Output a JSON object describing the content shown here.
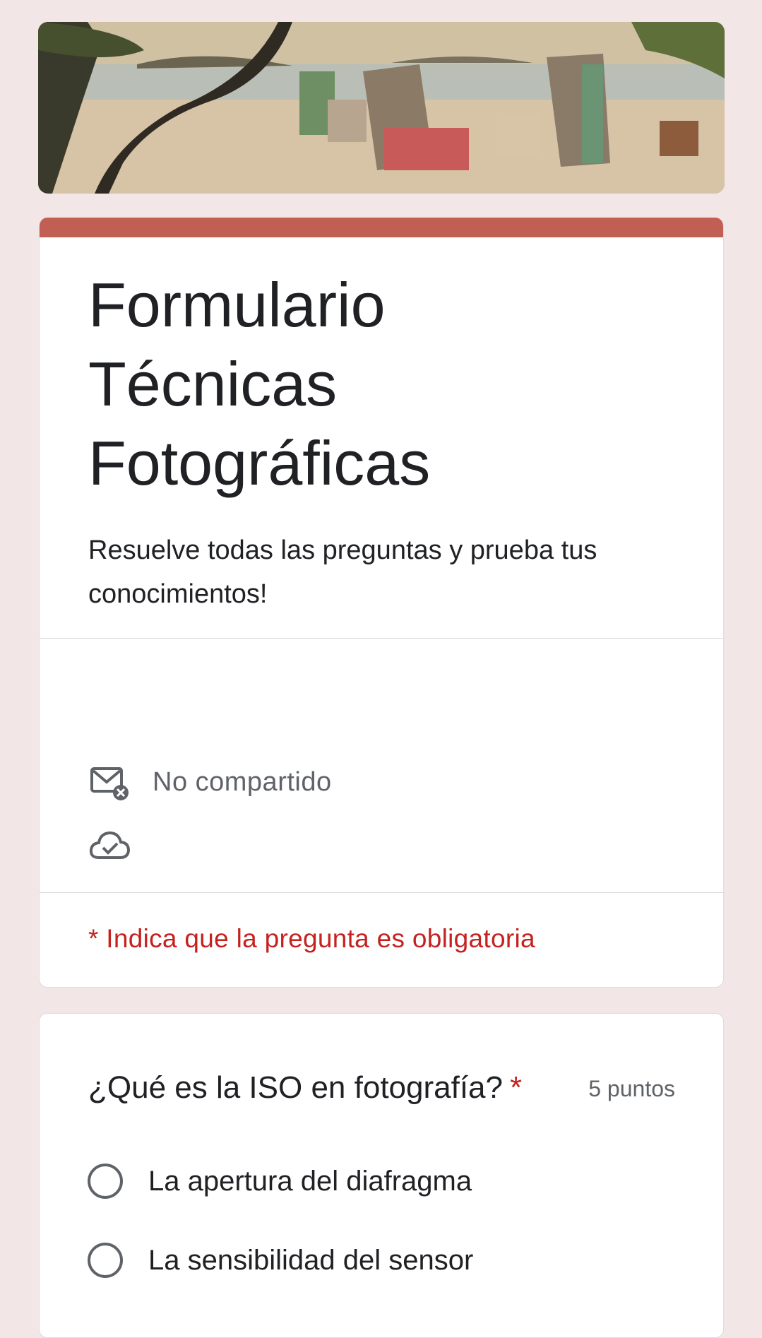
{
  "banner": {
    "icon": "beach-banner-image"
  },
  "colors": {
    "background": "#f2e6e6",
    "accent": "#c25f55",
    "required": "#c5221f"
  },
  "form": {
    "title": " Formulario\nTécnicas\nFotográficas",
    "description": "Resuelve todas las preguntas y prueba tus conocimientos!",
    "email_status": "No compartido",
    "email_icon": "mail-not-shared-icon",
    "cloud_icon": "cloud-check-icon",
    "required_note": "* Indica que la pregunta es obligatoria"
  },
  "question": {
    "title": "¿Qué es la ISO en fotografía?",
    "required_mark": "*",
    "points": "5 puntos",
    "options": [
      {
        "label": "La apertura del diafragma"
      },
      {
        "label": "La sensibilidad del sensor"
      }
    ]
  }
}
